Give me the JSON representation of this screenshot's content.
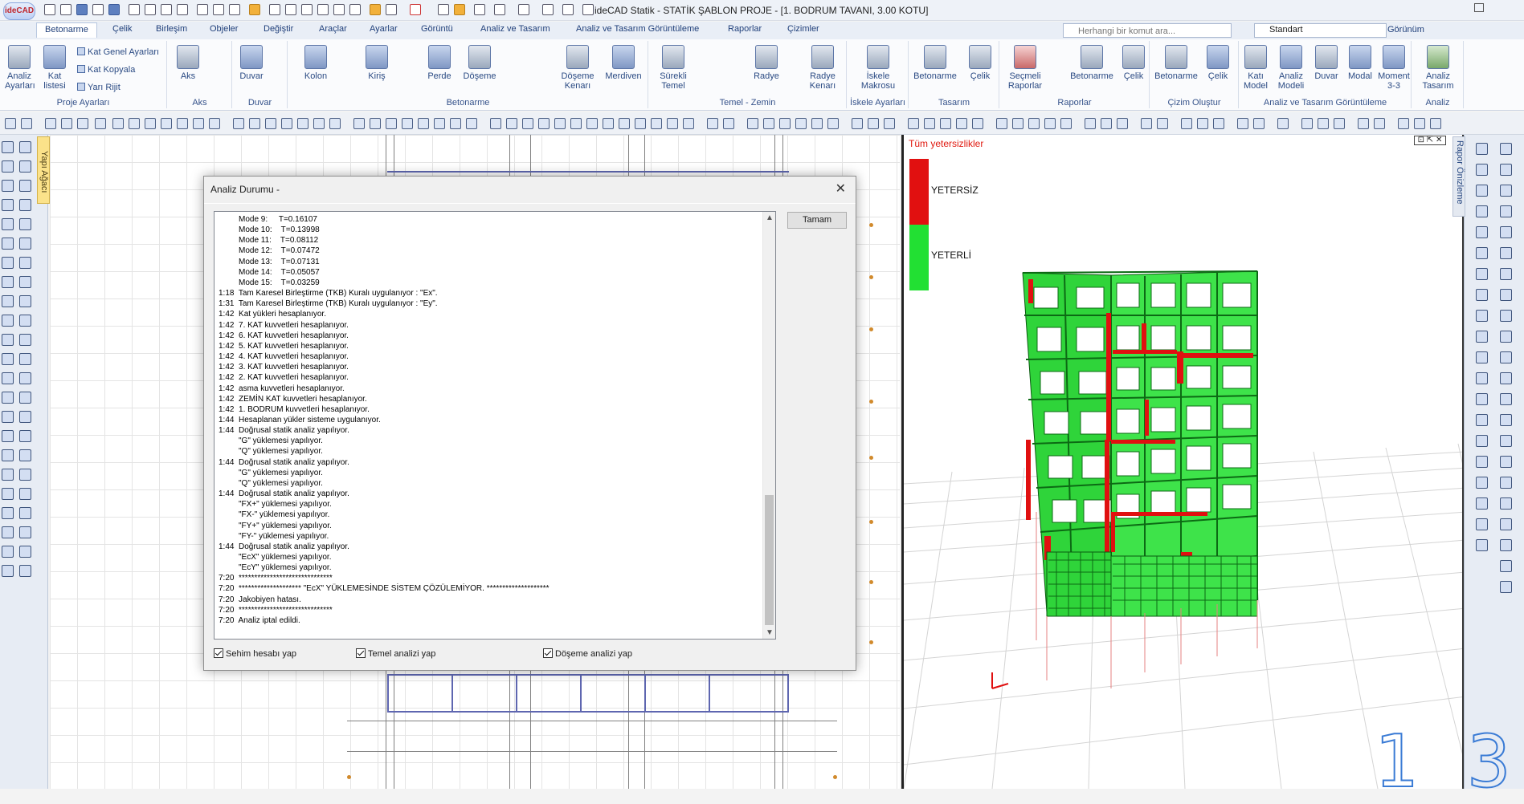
{
  "app": {
    "logo_text": "ideCAD",
    "title": "ideCAD Statik - STATİK ŞABLON PROJE - [1. BODRUM TAVANI,  3.00 KOTU]"
  },
  "tabs": [
    "Betonarme",
    "Çelik",
    "Birleşim",
    "Objeler",
    "Değiştir",
    "Araçlar",
    "Ayarlar",
    "Görüntü",
    "Analiz ve Tasarım",
    "Analiz ve Tasarım Görüntüleme",
    "Raporlar",
    "Çizimler"
  ],
  "active_tab": "Betonarme",
  "command_search": {
    "placeholder": "Herhangi bir komut ara..."
  },
  "style_combo": {
    "value": "Standart"
  },
  "view_menu": "Görünüm",
  "ribbon": {
    "proje": {
      "label": "Proje Ayarları",
      "analiz": "Analiz\nAyarları",
      "kat": "Kat\nlistesi",
      "kat_genel": "Kat Genel Ayarları",
      "kat_kopyala": "Kat Kopyala",
      "yari_rijit": "Yarı Rijit"
    },
    "aks": {
      "label": "Aks",
      "btn": "Aks"
    },
    "duvar": {
      "label": "Duvar",
      "btn": "Duvar"
    },
    "betonarme": {
      "label": "Betonarme",
      "kolon": "Kolon",
      "kiris": "Kiriş",
      "perde": "Perde",
      "doseme": "Döşeme",
      "doseme_kenari": "Döşeme\nKenarı",
      "merdiven": "Merdiven"
    },
    "temel": {
      "label": "Temel - Zemin",
      "surekli": "Sürekli\nTemel",
      "radye": "Radye",
      "radye_kenari": "Radye\nKenarı"
    },
    "iskele": {
      "label": "İskele Ayarları",
      "btn": "İskele\nMakrosu"
    },
    "tasarim": {
      "label": "Tasarım",
      "betonarme": "Betonarme",
      "celik": "Çelik"
    },
    "raporlar": {
      "label": "Raporlar",
      "secmeli": "Seçmeli\nRaporlar",
      "betonarme": "Betonarme",
      "celik": "Çelik"
    },
    "cizim": {
      "label": "Çizim Oluştur",
      "betonarme": "Betonarme",
      "celik": "Çelik"
    },
    "atg": {
      "label": "Analiz ve Tasarım Görüntüleme",
      "kati_model": "Katı\nModel",
      "analiz_modeli": "Analiz\nModeli",
      "duvar": "Duvar",
      "modal": "Modal",
      "moment": "Moment\n3-3"
    },
    "analiz": {
      "label": "Analiz",
      "btn": "Analiz\nTasarım"
    }
  },
  "side_panels": {
    "left": "Yapı Ağacı",
    "right": "Rapor Önizleme"
  },
  "view3d": {
    "legend_title": "Tüm yetersizlikler",
    "legend_insufficient": "YETERSİZ",
    "legend_sufficient": "YETERLİ",
    "colors": {
      "insufficient": "#e11010",
      "sufficient": "#22e033"
    }
  },
  "dialog": {
    "title": "Analiz Durumu -",
    "ok_button": "Tamam",
    "log": [
      "         Mode 9:     T=0.16107",
      "         Mode 10:    T=0.13998",
      "         Mode 11:    T=0.08112",
      "         Mode 12:    T=0.07472",
      "         Mode 13:    T=0.07131",
      "         Mode 14:    T=0.05057",
      "         Mode 15:    T=0.03259",
      "1:18  Tam Karesel Birleştirme (TKB) Kuralı uygulanıyor : \"Ex\".",
      "1:31  Tam Karesel Birleştirme (TKB) Kuralı uygulanıyor : \"Ey\".",
      "1:42  Kat yükleri hesaplanıyor.",
      "1:42  7. KAT kuvvetleri hesaplanıyor.",
      "1:42  6. KAT kuvvetleri hesaplanıyor.",
      "1:42  5. KAT kuvvetleri hesaplanıyor.",
      "1:42  4. KAT kuvvetleri hesaplanıyor.",
      "1:42  3. KAT kuvvetleri hesaplanıyor.",
      "1:42  2. KAT kuvvetleri hesaplanıyor.",
      "1:42  asma kuvvetleri hesaplanıyor.",
      "1:42  ZEMİN KAT kuvvetleri hesaplanıyor.",
      "1:42  1. BODRUM kuvvetleri hesaplanıyor.",
      "1:44  Hesaplanan yükler sisteme uygulanıyor.",
      "1:44  Doğrusal statik analiz yapılıyor.",
      "         \"G\" yüklemesi yapılıyor.",
      "         \"Q\" yüklemesi yapılıyor.",
      "1:44  Doğrusal statik analiz yapılıyor.",
      "         \"G\" yüklemesi yapılıyor.",
      "         \"Q\" yüklemesi yapılıyor.",
      "1:44  Doğrusal statik analiz yapılıyor.",
      "         \"FX+\" yüklemesi yapılıyor.",
      "         \"FX-\" yüklemesi yapılıyor.",
      "         \"FY+\" yüklemesi yapılıyor.",
      "         \"FY-\" yüklemesi yapılıyor.",
      "1:44  Doğrusal statik analiz yapılıyor.",
      "         \"EcX\" yüklemesi yapılıyor.",
      "         \"EcY\" yüklemesi yapılıyor.",
      "7:20  ******************************",
      "7:20  ******************** \"EcX\" YÜKLEMESİNDE SİSTEM ÇÖZÜLEMİYOR. ********************",
      "7:20  Jakobiyen hatası.",
      "7:20  ******************************",
      "7:20  Analiz iptal edildi."
    ],
    "checkboxes": [
      {
        "label": "Sehim hesabı yap",
        "checked": true
      },
      {
        "label": "Temel analizi yap",
        "checked": true
      },
      {
        "label": "Döşeme analizi yap",
        "checked": true
      }
    ]
  }
}
